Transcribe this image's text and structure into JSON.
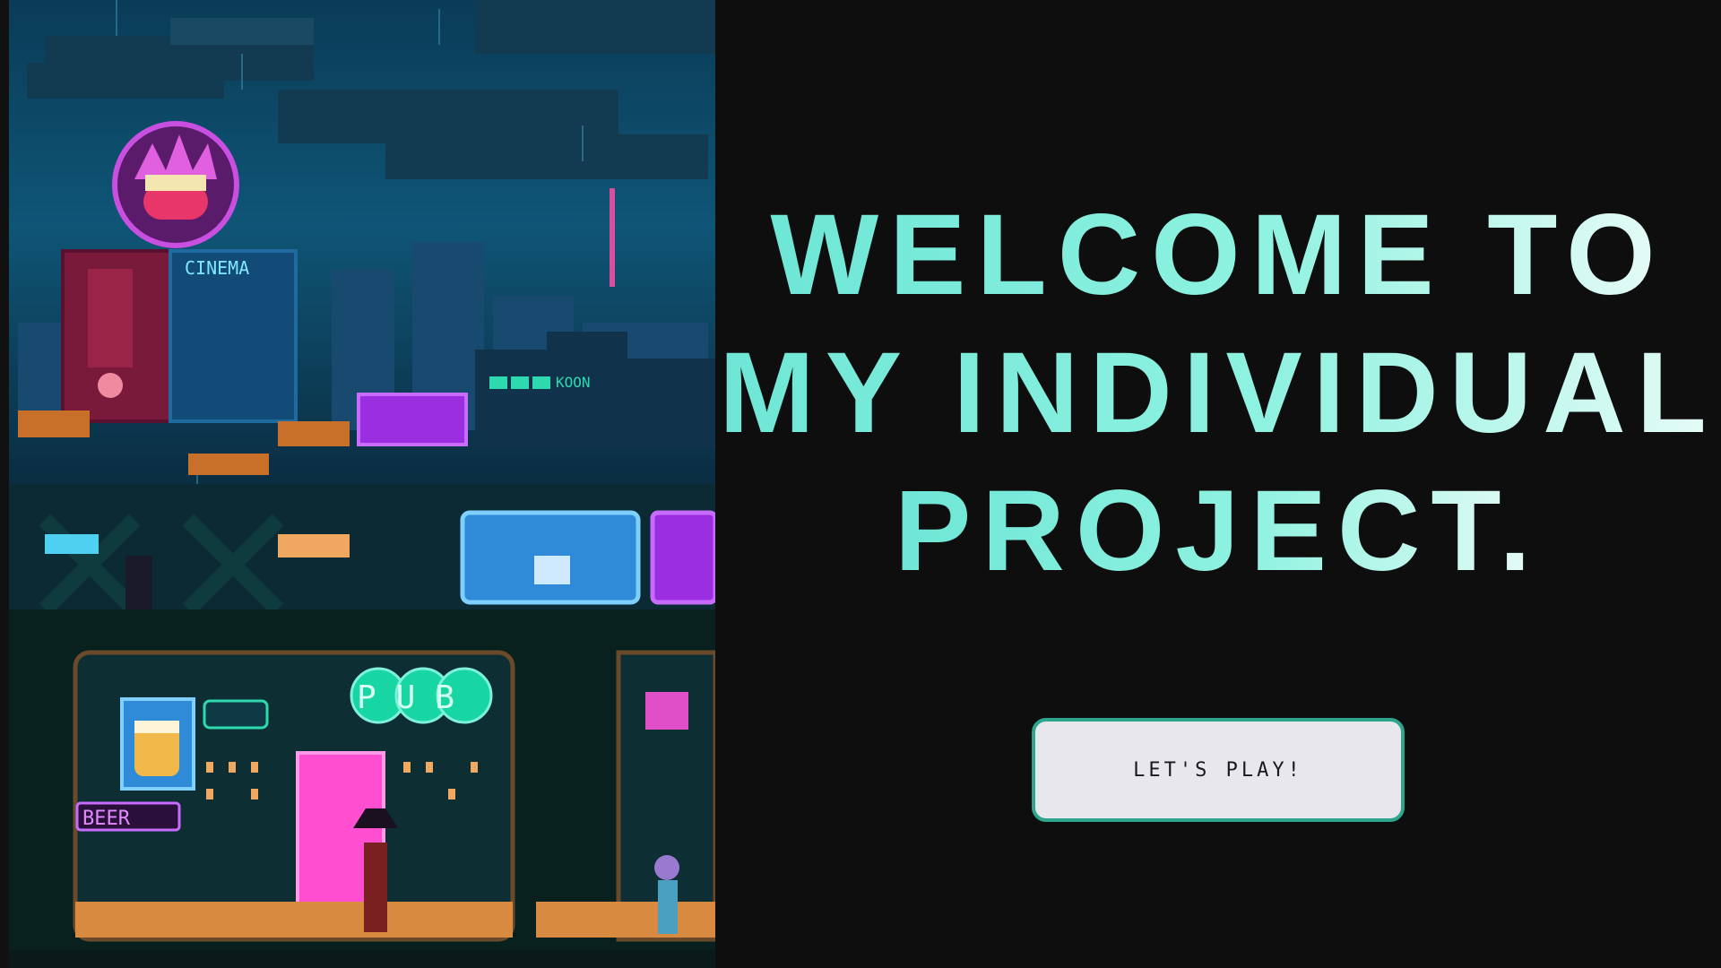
{
  "hero": {
    "title_line1": "WELCOME TO",
    "title_line2": "MY INDIVIDUAL",
    "title_line3": "PROJECT.",
    "gradient_start": "#6ee6d6",
    "gradient_end": "#e6fbf7"
  },
  "cta": {
    "label": "LET'S PLAY!",
    "border_color": "#2fa58e",
    "background": "#e9e7ee"
  },
  "illustration": {
    "signs": {
      "cinema": "CINEMA",
      "pub": "PUB",
      "beer": "BEER",
      "koon": "KOON"
    }
  },
  "colors": {
    "page_background": "#0e0e0e",
    "accent": "#7ff0dc"
  }
}
